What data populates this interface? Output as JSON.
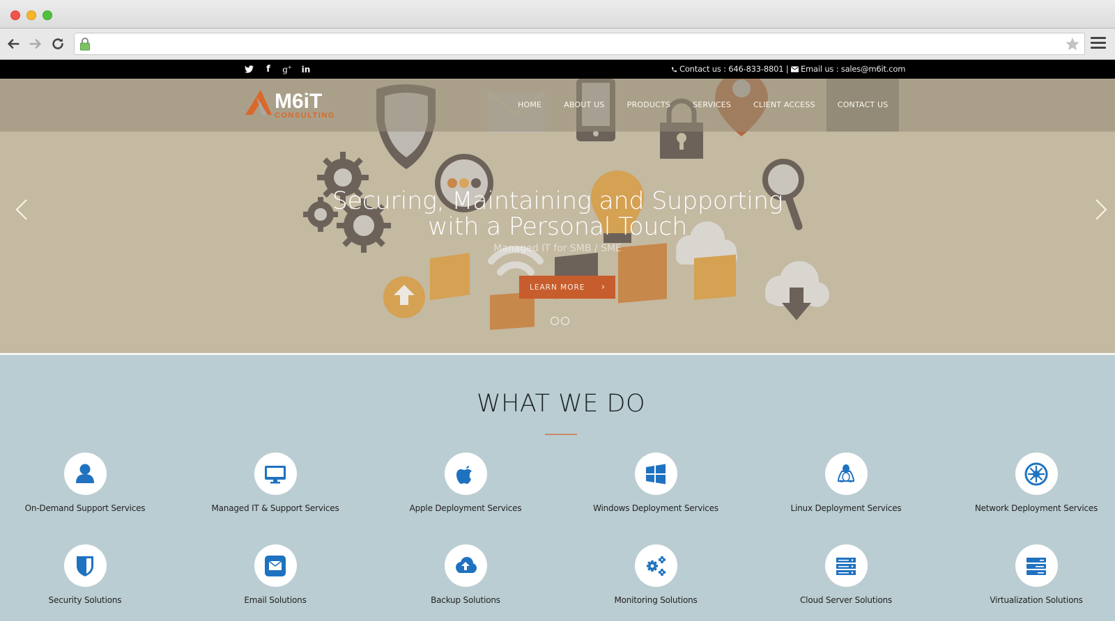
{
  "browser": {
    "url": "",
    "url_placeholder": ""
  },
  "topbar": {
    "social": [
      "twitter",
      "facebook",
      "google-plus",
      "linkedin"
    ],
    "contact_text": "Contact us : 646-833-8801",
    "separator": "|",
    "email_text": "Email us : sales@m6it.com"
  },
  "header": {
    "logo_text": "M6iT",
    "logo_subtext": "CONSULTING",
    "nav": [
      {
        "label": "HOME"
      },
      {
        "label": "ABOUT US"
      },
      {
        "label": "PRODUCTS"
      },
      {
        "label": "SERVICES"
      },
      {
        "label": "CLIENT ACCESS"
      },
      {
        "label": "CONTACT US",
        "active": true
      }
    ]
  },
  "hero": {
    "title_line1": "Securing, Maintaining and Supporting",
    "title_line2": "with a Personal Touch",
    "subtitle": "Managed IT for SMB / SME",
    "cta_label": "LEARN MORE",
    "cta_chevron": "›",
    "slide_count": 2,
    "accent_color": "#c75d2c"
  },
  "section": {
    "title": "WHAT WE DO",
    "icon_color": "#1f72c0",
    "services": [
      {
        "label": "On-Demand Support Services",
        "icon": "user-icon"
      },
      {
        "label": "Managed IT & Support Services",
        "icon": "desktop-icon"
      },
      {
        "label": "Apple Deployment Services",
        "icon": "apple-icon"
      },
      {
        "label": "Windows Deployment Services",
        "icon": "windows-icon"
      },
      {
        "label": "Linux Deployment Services",
        "icon": "linux-icon"
      },
      {
        "label": "Network Deployment Services",
        "icon": "network-icon"
      },
      {
        "label": "Security Solutions",
        "icon": "shield-icon"
      },
      {
        "label": "Email Solutions",
        "icon": "envelope-icon"
      },
      {
        "label": "Backup Solutions",
        "icon": "cloud-upload-icon"
      },
      {
        "label": "Monitoring Solutions",
        "icon": "gears-icon"
      },
      {
        "label": "Cloud Server Solutions",
        "icon": "server-icon"
      },
      {
        "label": "Virtualization Solutions",
        "icon": "server-stack-icon"
      }
    ]
  }
}
